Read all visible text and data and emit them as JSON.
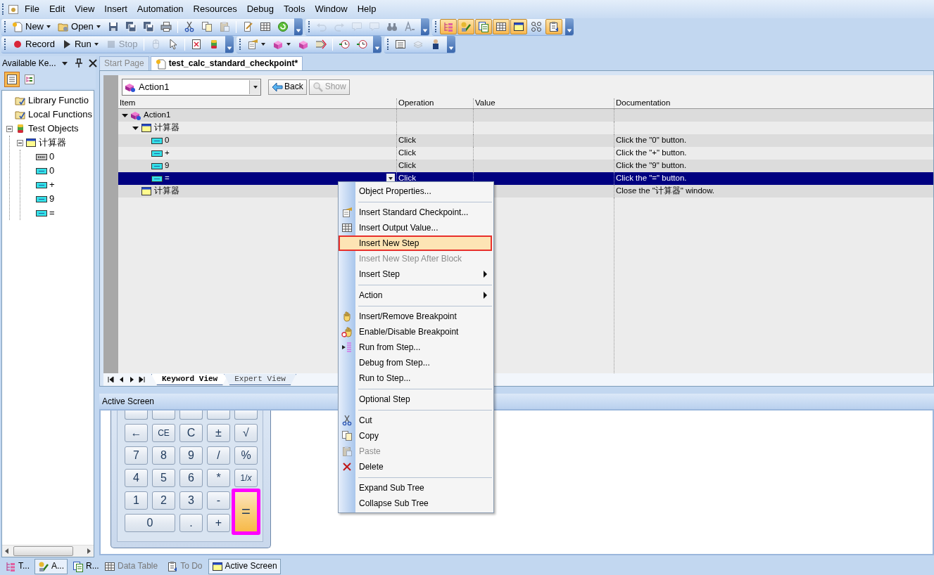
{
  "menu": [
    "File",
    "Edit",
    "View",
    "Insert",
    "Automation",
    "Resources",
    "Debug",
    "Tools",
    "Window",
    "Help"
  ],
  "toolbars": [
    [
      [
        {
          "kind": "labeled",
          "label": "New",
          "dropdown": true,
          "disabled": false
        },
        {
          "kind": "labeled",
          "label": "Open",
          "dropdown": true,
          "disabled": false
        },
        {
          "kind": "icon",
          "disabled": false
        },
        {
          "kind": "icon",
          "disabled": false
        },
        {
          "kind": "icon",
          "disabled": false
        },
        {
          "kind": "icon",
          "disabled": false
        },
        {
          "kind": "separator"
        },
        {
          "kind": "icon",
          "disabled": false
        },
        {
          "kind": "icon",
          "disabled": false
        },
        {
          "kind": "icon",
          "disabled": true
        },
        {
          "kind": "separator"
        },
        {
          "kind": "icon",
          "disabled": false
        },
        {
          "kind": "icon",
          "disabled": false
        },
        {
          "kind": "icon",
          "disabled": false
        }
      ],
      [
        {
          "kind": "icon",
          "disabled": true
        },
        {
          "kind": "icon",
          "disabled": true
        },
        {
          "kind": "icon",
          "disabled": true
        },
        {
          "kind": "icon",
          "disabled": true
        },
        {
          "kind": "icon",
          "disabled": false
        },
        {
          "kind": "icon",
          "disabled": false
        }
      ],
      [
        {
          "kind": "icon",
          "disabled": false,
          "pressed": true
        },
        {
          "kind": "icon",
          "disabled": false,
          "pressed": true
        },
        {
          "kind": "icon",
          "disabled": false,
          "pressed": true
        },
        {
          "kind": "icon",
          "disabled": false,
          "pressed": true
        },
        {
          "kind": "icon",
          "disabled": false,
          "pressed": true
        },
        {
          "kind": "icon",
          "disabled": false,
          "pressed": false
        },
        {
          "kind": "icon",
          "disabled": false,
          "pressed": true
        }
      ]
    ],
    [
      [
        {
          "kind": "labeled",
          "label": "Record",
          "dropdown": false,
          "disabled": false
        },
        {
          "kind": "labeled",
          "label": "Run",
          "dropdown": true,
          "disabled": false
        },
        {
          "kind": "labeled",
          "label": "Stop",
          "dropdown": false,
          "disabled": true
        },
        {
          "kind": "separator"
        },
        {
          "kind": "icon",
          "disabled": true
        },
        {
          "kind": "icon",
          "disabled": false
        },
        {
          "kind": "separator"
        },
        {
          "kind": "icon",
          "disabled": false
        },
        {
          "kind": "icon",
          "disabled": false
        }
      ],
      [
        {
          "kind": "icon",
          "disabled": false,
          "dropdown": true
        },
        {
          "kind": "icon",
          "disabled": false,
          "dropdown": true
        },
        {
          "kind": "icon",
          "disabled": false,
          "dropdown": false
        },
        {
          "kind": "icon",
          "disabled": false,
          "dropdown": false
        },
        {
          "kind": "separator"
        },
        {
          "kind": "icon",
          "disabled": false,
          "dropdown": false
        },
        {
          "kind": "icon",
          "disabled": false,
          "dropdown": false
        }
      ],
      [
        {
          "kind": "icon",
          "disabled": false
        },
        {
          "kind": "icon",
          "disabled": true
        },
        {
          "kind": "icon",
          "disabled": false
        }
      ]
    ]
  ],
  "left_panel": {
    "title": "Available Ke...",
    "view_buttons": [
      {
        "selected": true
      },
      {
        "selected": false
      }
    ],
    "tree": [
      {
        "label": "Library Functio",
        "kind": "functions"
      },
      {
        "label": "Local Functions",
        "kind": "functions"
      },
      {
        "label": "Test Objects",
        "kind": "objects",
        "expanded": true,
        "children": [
          {
            "label": "计算器",
            "kind": "window",
            "expanded": true,
            "children": [
              {
                "label": "0",
                "kind": "static"
              },
              {
                "label": "0",
                "kind": "button"
              },
              {
                "label": "+",
                "kind": "button"
              },
              {
                "label": "9",
                "kind": "button"
              },
              {
                "label": "=",
                "kind": "button"
              }
            ]
          }
        ]
      }
    ],
    "tabs": [
      {
        "label": "T...",
        "selected": false
      },
      {
        "label": "A...",
        "selected": true
      },
      {
        "label": "R...",
        "selected": false
      }
    ]
  },
  "document_tabs": [
    {
      "label": "Start Page",
      "selected": false
    },
    {
      "label": "test_calc_standard_checkpoint*",
      "selected": true
    }
  ],
  "action_selector": {
    "value": "Action1"
  },
  "nav_buttons": [
    {
      "label": "Back",
      "disabled": false
    },
    {
      "label": "Show",
      "disabled": true
    }
  ],
  "grid": {
    "columns": [
      "Item",
      "Operation",
      "Value",
      "Documentation"
    ],
    "rows": [
      {
        "item": "Action1",
        "kind": "action",
        "expanded": true,
        "selected": false,
        "children": [
          {
            "item": "计算器",
            "kind": "window",
            "expanded": true,
            "selected": false,
            "children": [
              {
                "item": "0",
                "kind": "button",
                "operation": "Click",
                "documentation": "Click the \"0\" button.",
                "selected": false
              },
              {
                "item": "+",
                "kind": "button",
                "operation": "Click",
                "documentation": "Click the \"+\" button.",
                "selected": false
              },
              {
                "item": "9",
                "kind": "button",
                "operation": "Click",
                "documentation": "Click the \"9\" button.",
                "selected": false
              },
              {
                "item": "=",
                "kind": "button",
                "operation": "Click",
                "documentation": "Click the \"=\" button.",
                "selected": true
              }
            ]
          },
          {
            "item": "计算器",
            "kind": "window",
            "documentation": "Close the \"计算器\" window.",
            "selected": false
          }
        ]
      }
    ]
  },
  "view_tabs": [
    {
      "label": "Keyword View",
      "selected": true
    },
    {
      "label": "Expert View",
      "selected": false
    }
  ],
  "active_screen": {
    "title": "Active Screen",
    "calculator": {
      "keys": [
        {
          "label": "←",
          "wide": false,
          "tall": false,
          "highlighted": false
        },
        {
          "label": "CE",
          "wide": false,
          "tall": false,
          "highlighted": false
        },
        {
          "label": "C",
          "wide": false,
          "tall": false,
          "highlighted": false
        },
        {
          "label": "±",
          "wide": false,
          "tall": false,
          "highlighted": false
        },
        {
          "label": "√",
          "wide": false,
          "tall": false,
          "highlighted": false
        },
        {
          "label": "7",
          "wide": false,
          "tall": false,
          "highlighted": false
        },
        {
          "label": "8",
          "wide": false,
          "tall": false,
          "highlighted": false
        },
        {
          "label": "9",
          "wide": false,
          "tall": false,
          "highlighted": false
        },
        {
          "label": "/",
          "wide": false,
          "tall": false,
          "highlighted": false
        },
        {
          "label": "%",
          "wide": false,
          "tall": false,
          "highlighted": false
        },
        {
          "label": "4",
          "wide": false,
          "tall": false,
          "highlighted": false
        },
        {
          "label": "5",
          "wide": false,
          "tall": false,
          "highlighted": false
        },
        {
          "label": "6",
          "wide": false,
          "tall": false,
          "highlighted": false
        },
        {
          "label": "*",
          "wide": false,
          "tall": false,
          "highlighted": false
        },
        {
          "label": "1/*x*",
          "wide": false,
          "tall": false,
          "highlighted": false
        },
        {
          "label": "1",
          "wide": false,
          "tall": false,
          "highlighted": false
        },
        {
          "label": "2",
          "wide": false,
          "tall": false,
          "highlighted": false
        },
        {
          "label": "3",
          "wide": false,
          "tall": false,
          "highlighted": false
        },
        {
          "label": "-",
          "wide": false,
          "tall": false,
          "highlighted": false
        },
        {
          "label": "=",
          "wide": false,
          "tall": true,
          "highlighted": true
        },
        {
          "label": "0",
          "wide": true,
          "tall": false,
          "highlighted": false
        },
        {
          "label": ".",
          "wide": false,
          "tall": false,
          "highlighted": false
        },
        {
          "label": "+",
          "wide": false,
          "tall": false,
          "highlighted": false
        }
      ]
    }
  },
  "bottom_tabs": [
    {
      "label": "Data Table",
      "selected": false
    },
    {
      "label": "To Do",
      "selected": false
    },
    {
      "label": "Active Screen",
      "selected": true
    }
  ],
  "context_menu": {
    "items": [
      {
        "kind": "item",
        "label": "Object Properties...",
        "disabled": false,
        "submenu": false,
        "selected": false
      },
      {
        "kind": "separator"
      },
      {
        "kind": "item",
        "label": "Insert Standard Checkpoint...",
        "disabled": false,
        "submenu": false,
        "selected": false
      },
      {
        "kind": "item",
        "label": "Insert Output Value...",
        "disabled": false,
        "submenu": false,
        "selected": false
      },
      {
        "kind": "item",
        "label": "Insert New Step",
        "disabled": false,
        "submenu": false,
        "selected": true
      },
      {
        "kind": "item",
        "label": "Insert New Step After Block",
        "disabled": true,
        "submenu": false,
        "selected": false
      },
      {
        "kind": "item",
        "label": "Insert Step",
        "disabled": false,
        "submenu": true,
        "selected": false
      },
      {
        "kind": "separator"
      },
      {
        "kind": "item",
        "label": "Action",
        "disabled": false,
        "submenu": true,
        "selected": false
      },
      {
        "kind": "separator"
      },
      {
        "kind": "item",
        "label": "Insert/Remove Breakpoint",
        "disabled": false,
        "submenu": false,
        "selected": false
      },
      {
        "kind": "item",
        "label": "Enable/Disable Breakpoint",
        "disabled": false,
        "submenu": false,
        "selected": false
      },
      {
        "kind": "item",
        "label": "Run from Step...",
        "disabled": false,
        "submenu": false,
        "selected": false
      },
      {
        "kind": "item",
        "label": "Debug from Step...",
        "disabled": false,
        "submenu": false,
        "selected": false
      },
      {
        "kind": "item",
        "label": "Run to Step...",
        "disabled": false,
        "submenu": false,
        "selected": false
      },
      {
        "kind": "separator"
      },
      {
        "kind": "item",
        "label": "Optional Step",
        "disabled": false,
        "submenu": false,
        "selected": false
      },
      {
        "kind": "separator"
      },
      {
        "kind": "item",
        "label": "Cut",
        "disabled": false,
        "submenu": false,
        "selected": false
      },
      {
        "kind": "item",
        "label": "Copy",
        "disabled": false,
        "submenu": false,
        "selected": false
      },
      {
        "kind": "item",
        "label": "Paste",
        "disabled": true,
        "submenu": false,
        "selected": false
      },
      {
        "kind": "item",
        "label": "Delete",
        "disabled": false,
        "submenu": false,
        "selected": false
      },
      {
        "kind": "separator"
      },
      {
        "kind": "item",
        "label": "Expand Sub Tree",
        "disabled": false,
        "submenu": false,
        "selected": false
      },
      {
        "kind": "item",
        "label": "Collapse Sub Tree",
        "disabled": false,
        "submenu": false,
        "selected": false
      }
    ]
  }
}
